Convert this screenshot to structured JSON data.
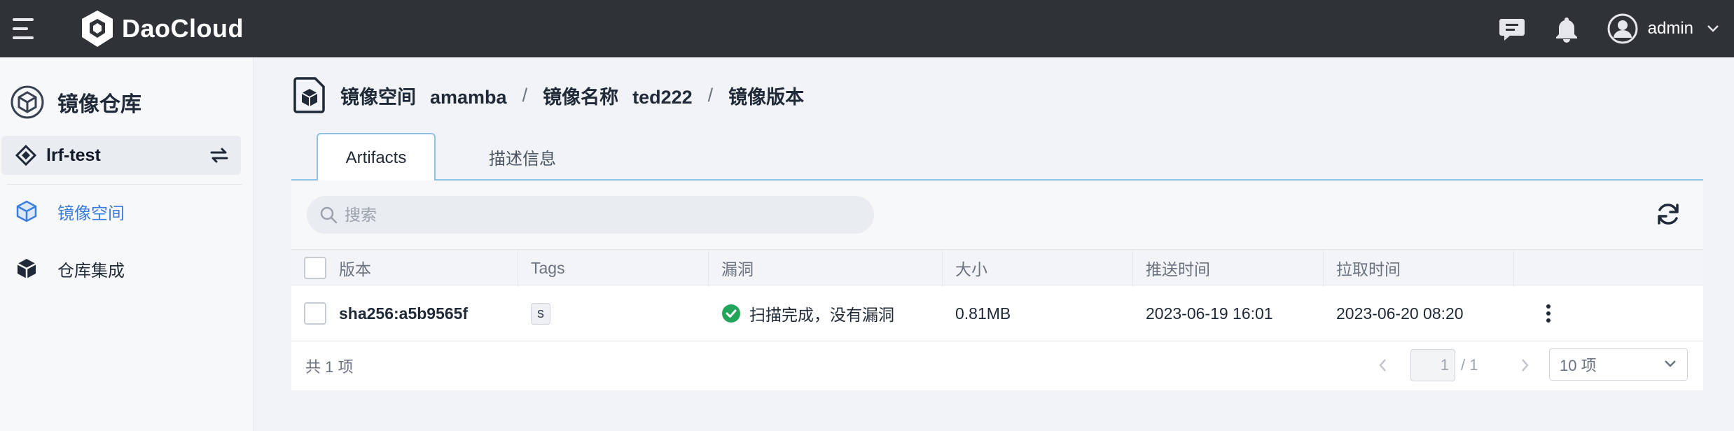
{
  "header": {
    "brand": "DaoCloud",
    "user": "admin"
  },
  "sidebar": {
    "title": "镜像仓库",
    "workspace": "lrf-test",
    "items": [
      {
        "label": "镜像空间",
        "active": true
      },
      {
        "label": "仓库集成",
        "active": false
      }
    ]
  },
  "breadcrumb": {
    "namespace_key": "镜像空间",
    "namespace_val": "amamba",
    "image_key": "镜像名称",
    "image_val": "ted222",
    "current": "镜像版本",
    "sep": "/"
  },
  "tabs": [
    {
      "label": "Artifacts",
      "active": true
    },
    {
      "label": "描述信息",
      "active": false
    }
  ],
  "search": {
    "placeholder": "搜索"
  },
  "table": {
    "columns": [
      "版本",
      "Tags",
      "漏洞",
      "大小",
      "推送时间",
      "拉取时间",
      ""
    ],
    "rows": [
      {
        "digest": "sha256:a5b9565f",
        "tag": "s",
        "vuln": "扫描完成，没有漏洞",
        "size": "0.81MB",
        "push_time": "2023-06-19 16:01",
        "pull_time": "2023-06-20 08:20"
      }
    ]
  },
  "footer": {
    "total": "共 1 项",
    "page": "1",
    "pages": "/ 1",
    "page_size": "10 项"
  },
  "colors": {
    "topbar": "#2f3237",
    "accent": "#3b7ddd",
    "success": "#22a55a",
    "tab_border": "#90c2e8"
  }
}
